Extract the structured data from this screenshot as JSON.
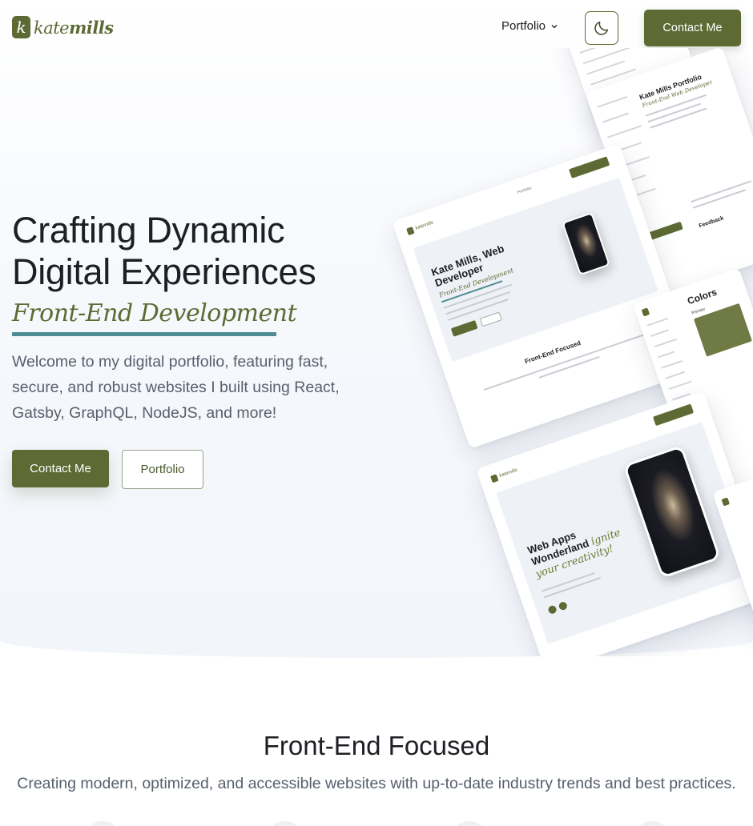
{
  "header": {
    "logo_mark": "k",
    "logo_first": "kate",
    "logo_last": "mills",
    "nav_portfolio": "Portfolio",
    "theme_icon": "moon-icon",
    "contact_label": "Contact Me"
  },
  "hero": {
    "title_line1": "Crafting Dynamic",
    "title_line2": "Digital Experiences",
    "subtitle": "Front-End Development",
    "description": "Welcome to my digital portfolio, featuring fast, secure, and robust websites I built using React, Gatsby, GraphQL, NodeJS, and more!",
    "contact_button": "Contact Me",
    "portfolio_button": "Portfolio"
  },
  "mockups": {
    "card1_title": "Kate Mills, Web Developer",
    "card1_sub": "Front-End Development",
    "card1_caption": "Front-End Focused",
    "card2_title": "Kate Mills Portfolio",
    "card2_sub": "Front-End Web Developer",
    "card2_feedback": "Feedback",
    "card3_title_a": "Web Apps",
    "card3_title_b": "Wonderland",
    "card3_accent": "ignite your creativity!",
    "card4_title": "Colors",
    "card4_primary": "Primary",
    "mini_logo_text": "katemills",
    "mini_portfolio": "Portfolio",
    "mini_contact": "Contact Me"
  },
  "section2": {
    "title": "Front-End Focused",
    "description": "Creating modern, optimized, and accessible websites with up-to-date industry trends and best practices."
  },
  "colors": {
    "brand": "#5e6a34",
    "accent_underline": "#4f8d95"
  }
}
